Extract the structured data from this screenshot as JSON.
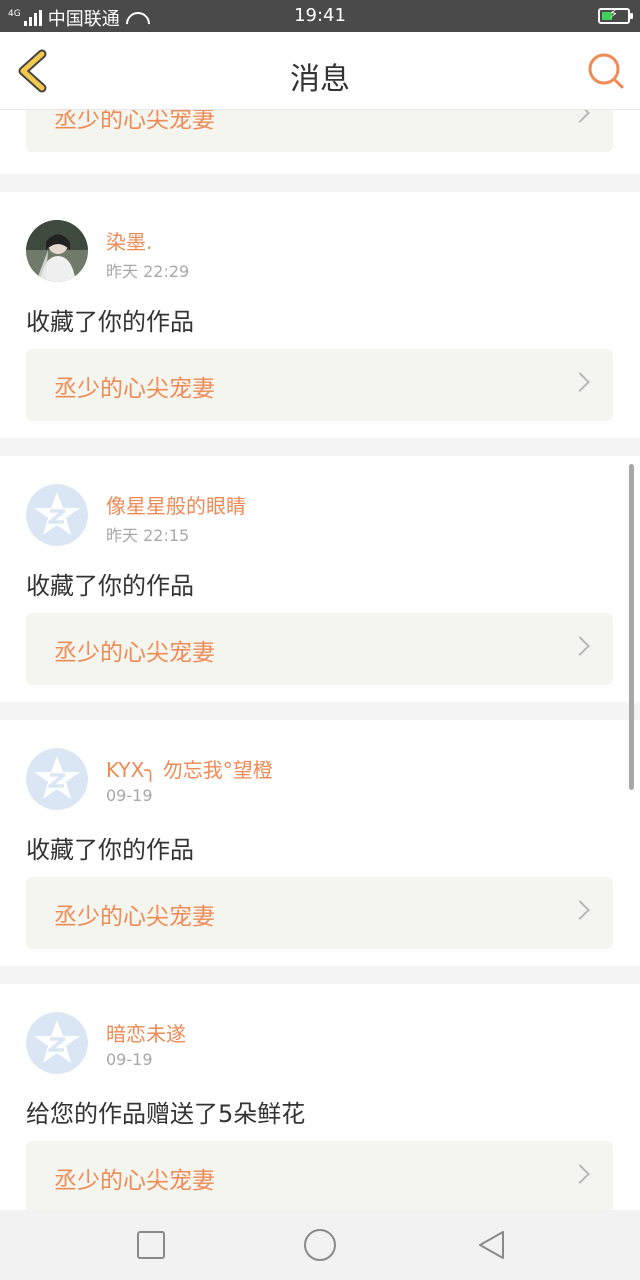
{
  "status_bar": {
    "network": "4G",
    "carrier": "中国联通",
    "time": "19:41"
  },
  "header": {
    "title": "消息",
    "back_icon": "back-chevron-icon",
    "search_icon": "search-icon"
  },
  "work_title": "丞少的心尖宠妻",
  "notifications": [
    {
      "user": "染墨.",
      "time": "昨天 22:29",
      "action": "收藏了你的作品",
      "avatar": "photo"
    },
    {
      "user": "像星星般的眼睛",
      "time": "昨天 22:15",
      "action": "收藏了你的作品",
      "avatar": "default"
    },
    {
      "user": "KYX╮ 勿忘我°望橙",
      "time": "09-19",
      "action": "收藏了你的作品",
      "avatar": "default"
    },
    {
      "user": "暗恋未遂",
      "time": "09-19",
      "action": "给您的作品赠送了5朵鲜花",
      "avatar": "default"
    }
  ],
  "colors": {
    "accent": "#ef8a55",
    "back_icon": "#f2c94c",
    "work_bg": "#f5f5ef",
    "default_avatar": "#dbe6f4"
  },
  "nav": {
    "recents_icon": "square-icon",
    "home_icon": "circle-icon",
    "back_icon": "triangle-back-icon"
  }
}
